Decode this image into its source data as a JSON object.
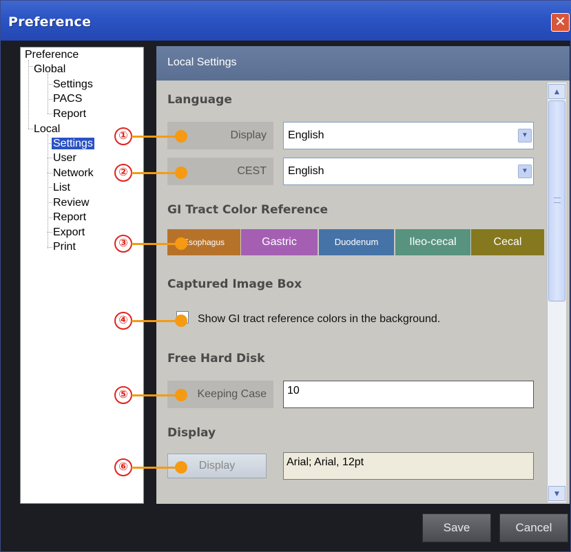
{
  "window": {
    "title": "Preference",
    "close_glyph": "✕"
  },
  "tree": {
    "items": [
      {
        "label": "Preference"
      },
      {
        "label": "Global"
      },
      {
        "label": "Settings"
      },
      {
        "label": "PACS"
      },
      {
        "label": "Report"
      },
      {
        "label": "Local"
      },
      {
        "label": "Settings",
        "selected": true
      },
      {
        "label": "User"
      },
      {
        "label": "Network"
      },
      {
        "label": "List"
      },
      {
        "label": "Review"
      },
      {
        "label": "Report"
      },
      {
        "label": "Export"
      },
      {
        "label": "Print"
      }
    ]
  },
  "panel": {
    "header": "Local Settings",
    "language": {
      "title": "Language",
      "display_label": "Display",
      "display_value": "English",
      "cest_label": "CEST",
      "cest_value": "English"
    },
    "gi_tract": {
      "title": "GI Tract Color Reference",
      "buttons": [
        {
          "label": "Esophagus",
          "color": "#b7722a"
        },
        {
          "label": "Gastric",
          "color": "#a45fb3"
        },
        {
          "label": "Duodenum",
          "color": "#4573a8"
        },
        {
          "label": "Ileo-cecal",
          "color": "#57937f"
        },
        {
          "label": "Cecal",
          "color": "#85781e"
        }
      ]
    },
    "captured": {
      "title": "Captured Image Box",
      "checkbox_label": "Show GI tract reference colors in the background.",
      "checked": false
    },
    "free_disk": {
      "title": "Free Hard Disk",
      "keeping_label": "Keeping Case",
      "keeping_value": "10"
    },
    "display": {
      "title": "Display",
      "button_label": "Display",
      "font_value": "Arial; Arial, 12pt"
    }
  },
  "footer": {
    "save": "Save",
    "cancel": "Cancel"
  },
  "callouts": [
    "①",
    "②",
    "③",
    "④",
    "⑤",
    "⑥"
  ],
  "colors": {
    "accent": "#f59a12",
    "callout_ring": "#e0231f",
    "titlebar": "#2b54c4"
  }
}
